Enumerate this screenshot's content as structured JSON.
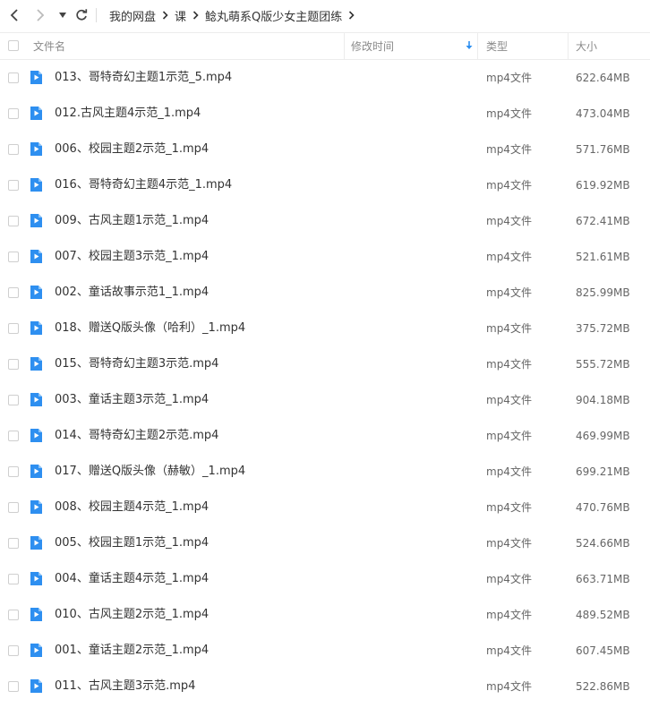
{
  "breadcrumb": [
    "我的网盘",
    "课",
    "鲶丸萌系Q版少女主题团练"
  ],
  "columns": {
    "name": "文件名",
    "modified": "修改时间",
    "type": "类型",
    "size": "大小"
  },
  "colors": {
    "file_icon": "#2e8ff0",
    "sort_arrow": "#2e8ff0"
  },
  "files": [
    {
      "name": "013、哥特奇幻主题1示范_5.mp4",
      "type": "mp4文件",
      "size": "622.64MB"
    },
    {
      "name": "012.古风主题4示范_1.mp4",
      "type": "mp4文件",
      "size": "473.04MB"
    },
    {
      "name": "006、校园主题2示范_1.mp4",
      "type": "mp4文件",
      "size": "571.76MB"
    },
    {
      "name": "016、哥特奇幻主题4示范_1.mp4",
      "type": "mp4文件",
      "size": "619.92MB"
    },
    {
      "name": "009、古风主题1示范_1.mp4",
      "type": "mp4文件",
      "size": "672.41MB"
    },
    {
      "name": "007、校园主题3示范_1.mp4",
      "type": "mp4文件",
      "size": "521.61MB"
    },
    {
      "name": "002、童话故事示范1_1.mp4",
      "type": "mp4文件",
      "size": "825.99MB"
    },
    {
      "name": "018、赠送Q版头像（哈利）_1.mp4",
      "type": "mp4文件",
      "size": "375.72MB"
    },
    {
      "name": "015、哥特奇幻主题3示范.mp4",
      "type": "mp4文件",
      "size": "555.72MB"
    },
    {
      "name": "003、童话主题3示范_1.mp4",
      "type": "mp4文件",
      "size": "904.18MB"
    },
    {
      "name": "014、哥特奇幻主题2示范.mp4",
      "type": "mp4文件",
      "size": "469.99MB"
    },
    {
      "name": "017、赠送Q版头像（赫敏）_1.mp4",
      "type": "mp4文件",
      "size": "699.21MB"
    },
    {
      "name": "008、校园主题4示范_1.mp4",
      "type": "mp4文件",
      "size": "470.76MB"
    },
    {
      "name": "005、校园主题1示范_1.mp4",
      "type": "mp4文件",
      "size": "524.66MB"
    },
    {
      "name": "004、童话主题4示范_1.mp4",
      "type": "mp4文件",
      "size": "663.71MB"
    },
    {
      "name": "010、古风主题2示范_1.mp4",
      "type": "mp4文件",
      "size": "489.52MB"
    },
    {
      "name": "001、童话主题2示范_1.mp4",
      "type": "mp4文件",
      "size": "607.45MB"
    },
    {
      "name": "011、古风主题3示范.mp4",
      "type": "mp4文件",
      "size": "522.86MB"
    }
  ]
}
